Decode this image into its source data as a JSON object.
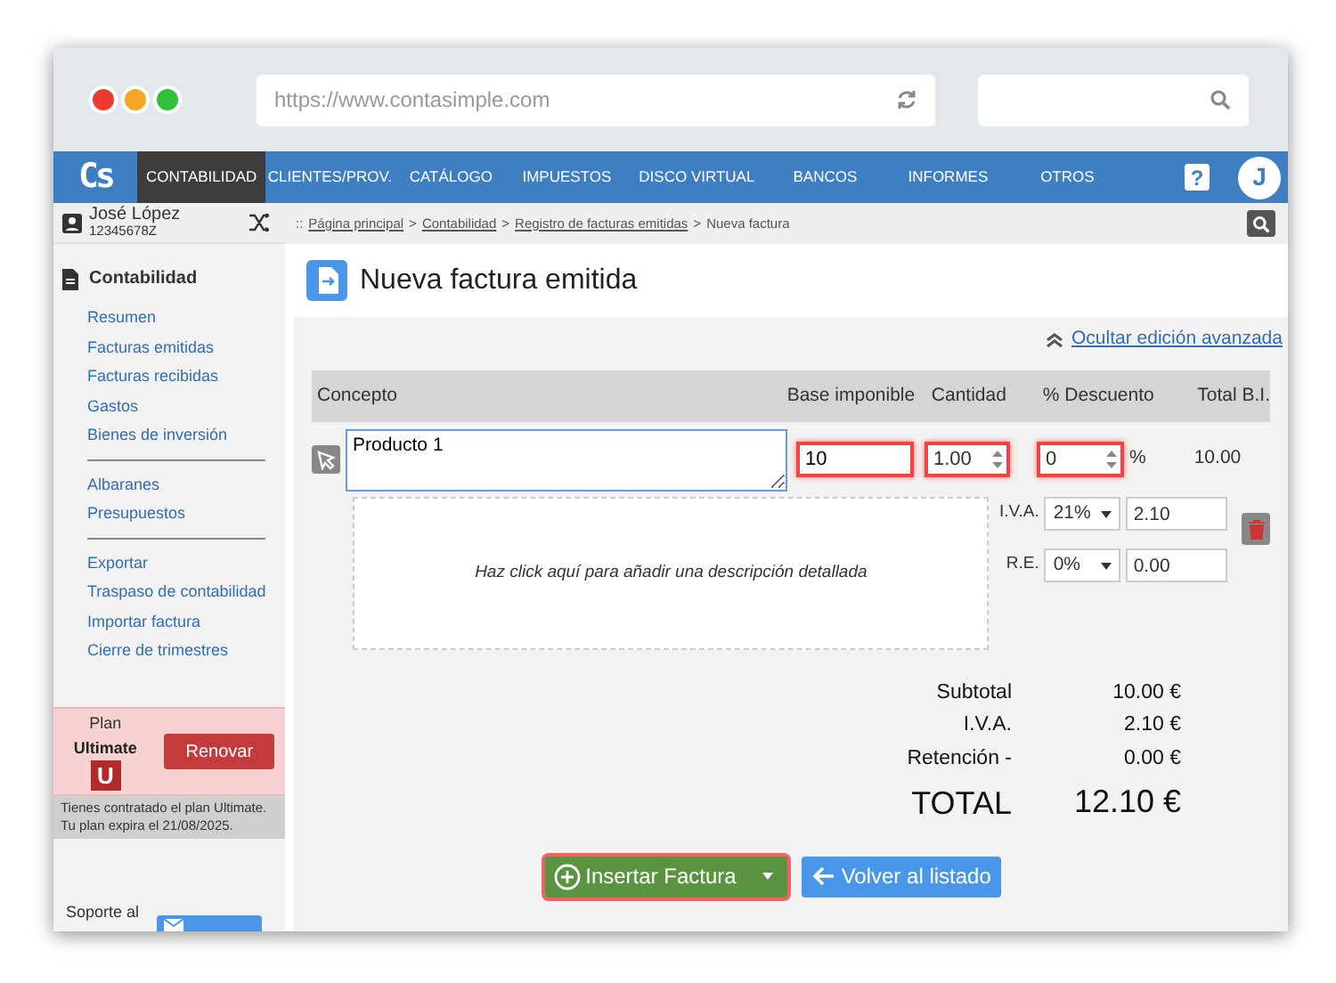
{
  "browser": {
    "url": "https://www.contasimple.com"
  },
  "nav": {
    "logo": "Cs",
    "items": [
      {
        "label": "CONTABILIDAD",
        "selected": true
      },
      {
        "label": "CLIENTES/PROV.",
        "selected": false
      },
      {
        "label": "CATÁLOGO",
        "selected": false
      },
      {
        "label": "IMPUESTOS",
        "selected": false
      },
      {
        "label": "DISCO VIRTUAL",
        "selected": false
      },
      {
        "label": "BANCOS",
        "selected": false
      },
      {
        "label": "INFORMES",
        "selected": false
      },
      {
        "label": "OTROS",
        "selected": false
      }
    ],
    "help": "?",
    "avatar": "J"
  },
  "user": {
    "name": "José López",
    "id": "12345678Z"
  },
  "breadcrumb": {
    "prefix": "::",
    "separator": ">",
    "links": [
      "Página principal",
      "Contabilidad",
      "Registro de facturas emitidas"
    ],
    "current": "Nueva factura"
  },
  "sidebar": {
    "title": "Contabilidad",
    "groups": [
      [
        "Resumen",
        "Facturas emitidas",
        "Facturas recibidas",
        "Gastos",
        "Bienes de inversión"
      ],
      [
        "Albaranes",
        "Presupuestos"
      ],
      [
        "Exportar",
        "Traspaso de contabilidad",
        "Importar factura",
        "Cierre de trimestres"
      ]
    ],
    "plan": {
      "label": "Plan",
      "name": "Ultimate",
      "badge": "U",
      "button": "Renovar",
      "note": "Tienes contratado el plan Ultimate. Tu plan expira el 21/08/2025."
    },
    "support": "Soporte al"
  },
  "page": {
    "title": "Nueva factura emitida",
    "advanced_link": "Ocultar edición avanzada"
  },
  "table": {
    "columns": [
      "Concepto",
      "Base imponible",
      "Cantidad",
      "% Descuento",
      "Total B.I."
    ],
    "rows": [
      {
        "concept": "Producto 1",
        "base": {
          "value": "10",
          "highlighted": true
        },
        "quantity": {
          "value": "1.00",
          "highlighted": true
        },
        "discount": {
          "value": "0",
          "highlighted": true
        },
        "discount_unit": "%",
        "total": "10.00",
        "description_placeholder": "Haz click aquí para añadir una descripción detallada",
        "iva": {
          "label": "I.V.A.",
          "rate": "21%",
          "amount": "2.10"
        },
        "re": {
          "label": "R.E.",
          "rate": "0%",
          "amount": "0.00"
        }
      }
    ]
  },
  "totals": [
    {
      "label": "Subtotal",
      "value": "10.00 €",
      "kind": "normal"
    },
    {
      "label": "I.V.A.",
      "value": "2.10 €",
      "kind": "normal"
    },
    {
      "label": "Retención -",
      "value": "0.00 €",
      "kind": "normal"
    },
    {
      "label": "TOTAL",
      "value": "12.10 €",
      "kind": "grand"
    }
  ],
  "actions": {
    "insert": {
      "label": "Insertar Factura",
      "highlighted": true
    },
    "back": "Volver al listado"
  }
}
